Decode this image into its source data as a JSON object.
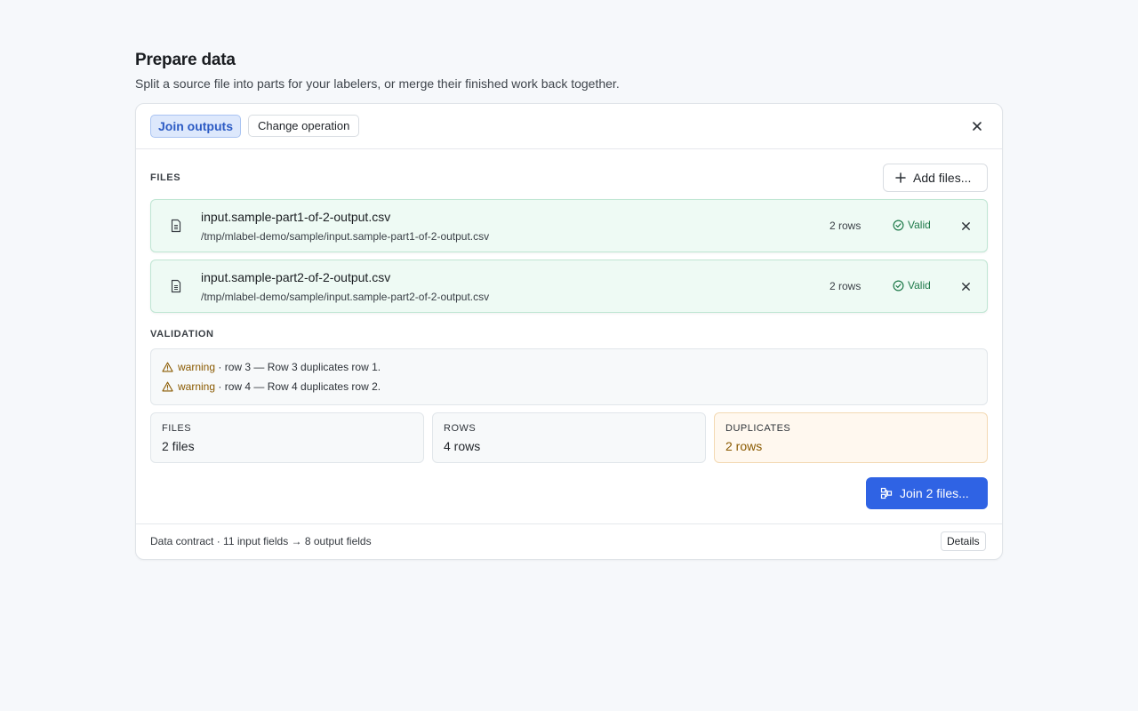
{
  "page": {
    "title": "Prepare data",
    "subtitle": "Split a source file into parts for your labelers, or merge their finished work back together."
  },
  "card": {
    "active_operation": "Join outputs",
    "change_operation_label": "Change operation",
    "files_section_label": "FILES",
    "add_files_label": "Add files...",
    "files": [
      {
        "name": "input.sample-part1-of-2-output.csv",
        "path": "/tmp/mlabel-demo/sample/input.sample-part1-of-2-output.csv",
        "rows": "2 rows",
        "status": "Valid"
      },
      {
        "name": "input.sample-part2-of-2-output.csv",
        "path": "/tmp/mlabel-demo/sample/input.sample-part2-of-2-output.csv",
        "rows": "2 rows",
        "status": "Valid"
      }
    ],
    "validation_section_label": "VALIDATION",
    "validation": [
      {
        "level": "warning",
        "text": " · row 3 — Row 3 duplicates row 1."
      },
      {
        "level": "warning",
        "text": " · row 4 — Row 4 duplicates row 2."
      }
    ],
    "stats": [
      {
        "label": "FILES",
        "value": "2 files"
      },
      {
        "label": "ROWS",
        "value": "4 rows"
      },
      {
        "label": "DUPLICATES",
        "value": "2 rows"
      }
    ],
    "join_button_label": "Join 2 files...",
    "footer_text": "Data contract · 11 input fields → 8 output fields",
    "details_label": "Details"
  },
  "colors": {
    "accent": "#2f63e4",
    "valid": "#1f7a4a",
    "warning": "#8a5a00",
    "file_row_bg": "#eefaf4"
  }
}
